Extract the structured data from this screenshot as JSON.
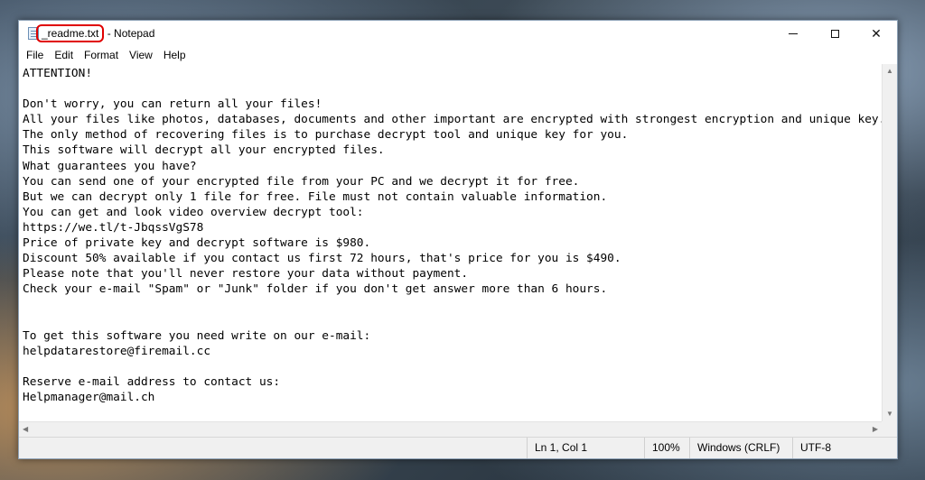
{
  "window": {
    "filename": "_readme.txt",
    "app_suffix": " - Notepad"
  },
  "menu": [
    "File",
    "Edit",
    "Format",
    "View",
    "Help"
  ],
  "editor": {
    "lines": [
      "ATTENTION!",
      "",
      "Don't worry, you can return all your files!",
      "All your files like photos, databases, documents and other important are encrypted with strongest encryption and unique key.",
      "The only method of recovering files is to purchase decrypt tool and unique key for you.",
      "This software will decrypt all your encrypted files.",
      "What guarantees you have?",
      "You can send one of your encrypted file from your PC and we decrypt it for free.",
      "But we can decrypt only 1 file for free. File must not contain valuable information.",
      "You can get and look video overview decrypt tool:",
      "https://we.tl/t-JbqssVgS78",
      "Price of private key and decrypt software is $980.",
      "Discount 50% available if you contact us first 72 hours, that's price for you is $490.",
      "Please note that you'll never restore your data without payment.",
      "Check your e-mail \"Spam\" or \"Junk\" folder if you don't get answer more than 6 hours.",
      "",
      "",
      "To get this software you need write on our e-mail:",
      "helpdatarestore@firemail.cc",
      "",
      "Reserve e-mail address to contact us:",
      "Helpmanager@mail.ch"
    ]
  },
  "status": {
    "position": "Ln 1, Col 1",
    "zoom": "100%",
    "line_ending": "Windows (CRLF)",
    "encoding": "UTF-8"
  },
  "icons": {
    "app": "notepad-icon",
    "minimize": "minimize-icon",
    "maximize": "maximize-icon",
    "close": "close-icon"
  },
  "colors": {
    "highlight_box": "#e00000"
  }
}
